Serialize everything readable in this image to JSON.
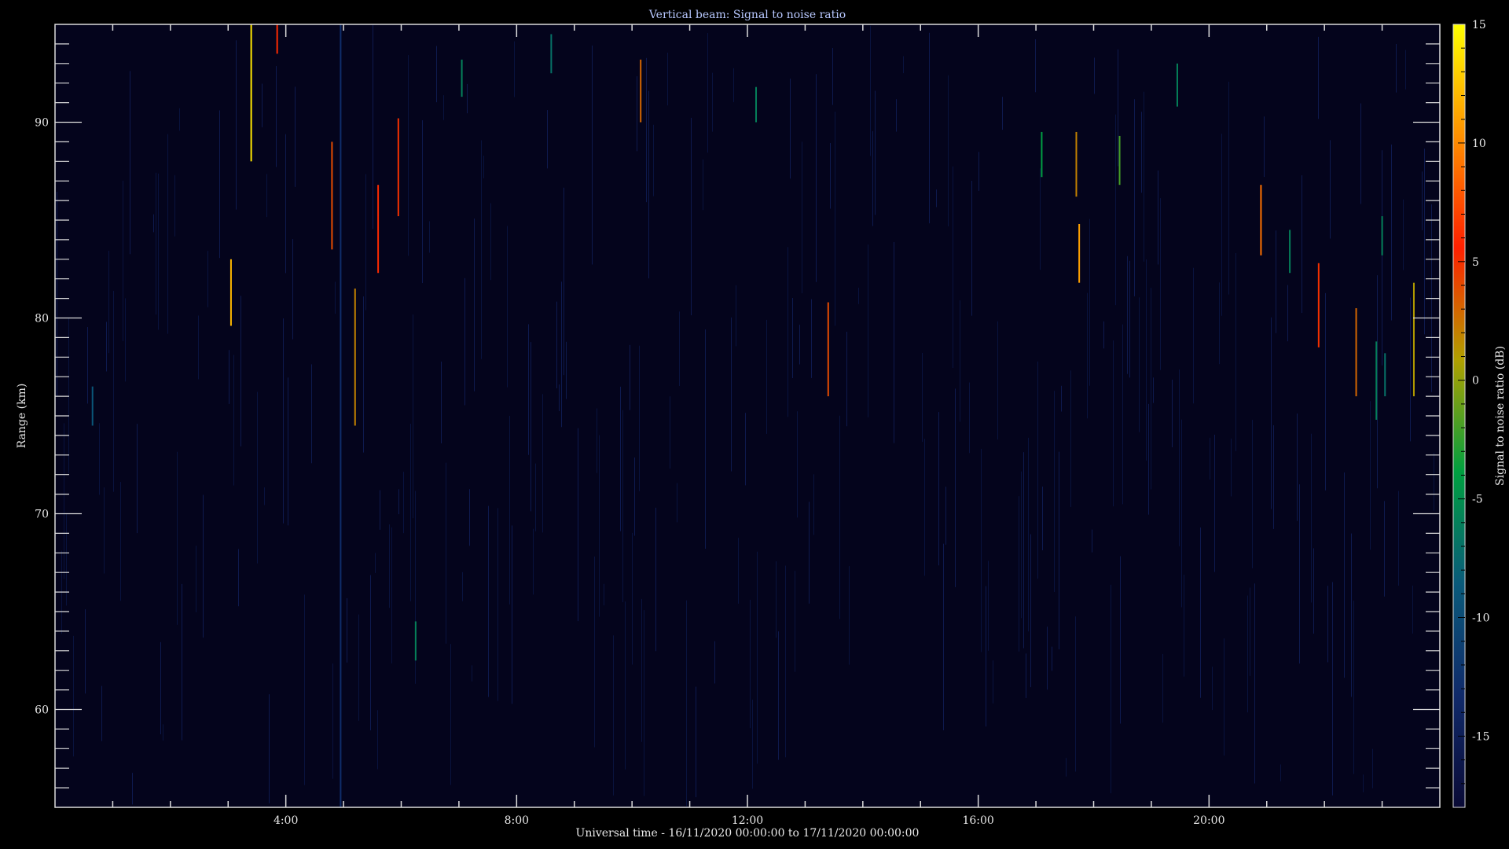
{
  "chart_data": {
    "type": "heatmap",
    "title": "Vertical beam: Signal to noise ratio",
    "xlabel": "Universal time - 16/11/2020 00:00:00 to 17/11/2020 00:00:00",
    "ylabel": "Range (km)",
    "xlim_hours": [
      0,
      24
    ],
    "ylim_km": [
      55,
      95
    ],
    "x_ticks": [
      {
        "hour": 4,
        "label": "4:00"
      },
      {
        "hour": 8,
        "label": "8:00"
      },
      {
        "hour": 12,
        "label": "12:00"
      },
      {
        "hour": 16,
        "label": "16:00"
      },
      {
        "hour": 20,
        "label": "20:00"
      }
    ],
    "y_ticks": [
      {
        "km": 60,
        "label": "60"
      },
      {
        "km": 70,
        "label": "70"
      },
      {
        "km": 80,
        "label": "80"
      },
      {
        "km": 90,
        "label": "90"
      }
    ],
    "colorbar": {
      "label": "Signal to noise ratio (dB)",
      "range_db": [
        -18,
        15
      ],
      "ticks": [
        {
          "db": 15,
          "label": "15"
        },
        {
          "db": 10,
          "label": "10"
        },
        {
          "db": 5,
          "label": "5"
        },
        {
          "db": 0,
          "label": "0"
        },
        {
          "db": -5,
          "label": "-5"
        },
        {
          "db": -10,
          "label": "-10"
        },
        {
          "db": -15,
          "label": "-15"
        }
      ],
      "colors": [
        "#0a0a35",
        "#102a6a",
        "#0a5a7a",
        "#00a040",
        "#b0a000",
        "#ff2000",
        "#ff9000",
        "#ffff00"
      ]
    },
    "background_snr_db": -17,
    "echoes": [
      {
        "hour": 0.65,
        "km_from": 74.5,
        "km_to": 76.5,
        "snr_db": -9
      },
      {
        "hour": 3.05,
        "km_from": 79.6,
        "km_to": 83.0,
        "snr_db": 12
      },
      {
        "hour": 3.4,
        "km_from": 88.0,
        "km_to": 95.0,
        "snr_db": 14
      },
      {
        "hour": 3.85,
        "km_from": 93.5,
        "km_to": 95.0,
        "snr_db": 6
      },
      {
        "hour": 4.8,
        "km_from": 83.5,
        "km_to": 89.0,
        "snr_db": 4
      },
      {
        "hour": 4.95,
        "km_from": 55.0,
        "km_to": 95.0,
        "snr_db": -13
      },
      {
        "hour": 5.2,
        "km_from": 74.5,
        "km_to": 81.5,
        "snr_db": 2
      },
      {
        "hour": 5.6,
        "km_from": 82.3,
        "km_to": 86.8,
        "snr_db": 6
      },
      {
        "hour": 5.95,
        "km_from": 85.2,
        "km_to": 90.2,
        "snr_db": 5
      },
      {
        "hour": 6.25,
        "km_from": 62.5,
        "km_to": 64.5,
        "snr_db": -6
      },
      {
        "hour": 7.05,
        "km_from": 91.3,
        "km_to": 93.2,
        "snr_db": -6
      },
      {
        "hour": 8.6,
        "km_from": 92.5,
        "km_to": 94.5,
        "snr_db": -7
      },
      {
        "hour": 10.15,
        "km_from": 90.0,
        "km_to": 93.2,
        "snr_db": 3
      },
      {
        "hour": 12.15,
        "km_from": 90.0,
        "km_to": 91.8,
        "snr_db": -6
      },
      {
        "hour": 13.4,
        "km_from": 76.0,
        "km_to": 80.8,
        "snr_db": 4
      },
      {
        "hour": 17.1,
        "km_from": 87.2,
        "km_to": 89.5,
        "snr_db": -4
      },
      {
        "hour": 17.7,
        "km_from": 86.2,
        "km_to": 89.5,
        "snr_db": 2
      },
      {
        "hour": 17.75,
        "km_from": 81.8,
        "km_to": 84.8,
        "snr_db": 11
      },
      {
        "hour": 18.45,
        "km_from": 86.8,
        "km_to": 89.3,
        "snr_db": -2
      },
      {
        "hour": 19.45,
        "km_from": 90.8,
        "km_to": 93.0,
        "snr_db": -6
      },
      {
        "hour": 20.9,
        "km_from": 83.2,
        "km_to": 86.8,
        "snr_db": 9
      },
      {
        "hour": 21.4,
        "km_from": 82.3,
        "km_to": 84.5,
        "snr_db": -6
      },
      {
        "hour": 21.9,
        "km_from": 78.5,
        "km_to": 82.8,
        "snr_db": 5
      },
      {
        "hour": 22.55,
        "km_from": 76.0,
        "km_to": 80.5,
        "snr_db": 3
      },
      {
        "hour": 22.9,
        "km_from": 74.8,
        "km_to": 78.8,
        "snr_db": -6
      },
      {
        "hour": 23.05,
        "km_from": 76.0,
        "km_to": 78.2,
        "snr_db": -7
      },
      {
        "hour": 23.0,
        "km_from": 83.2,
        "km_to": 85.2,
        "snr_db": -6
      },
      {
        "hour": 23.55,
        "km_from": 76.0,
        "km_to": 81.8,
        "snr_db": 1
      }
    ]
  }
}
